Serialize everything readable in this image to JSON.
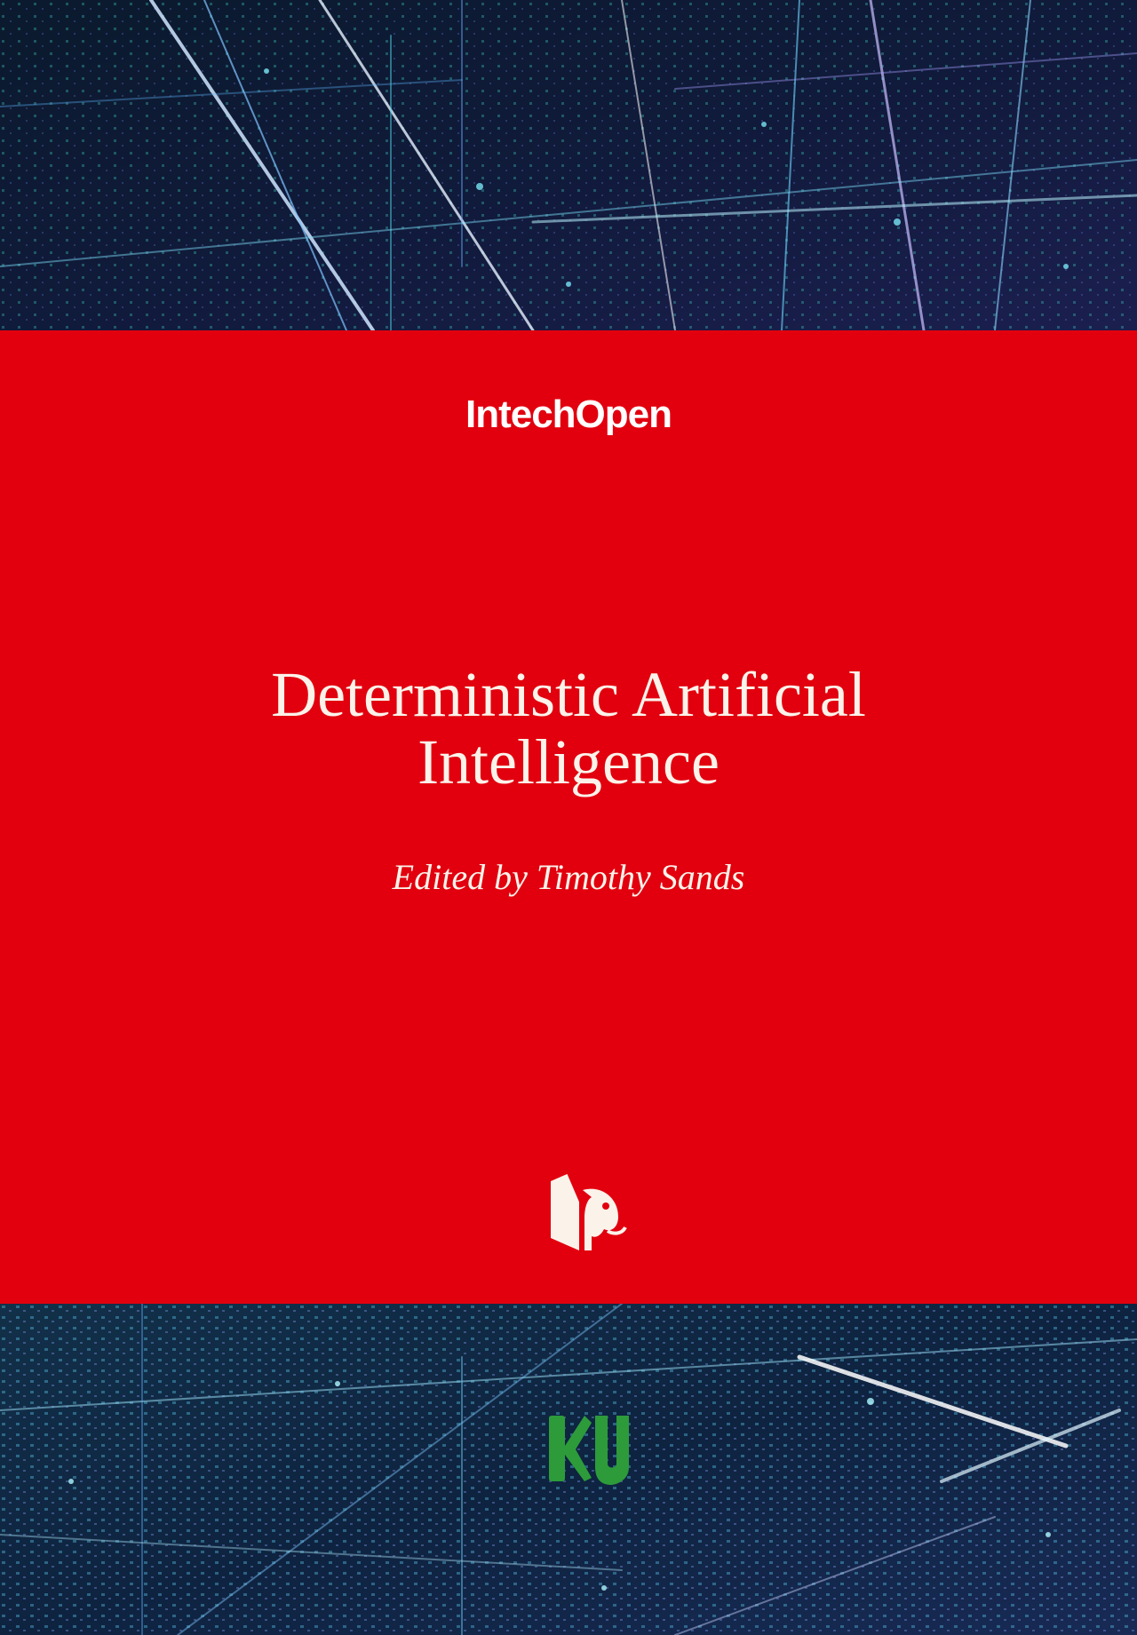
{
  "cover": {
    "publisher": "IntechOpen",
    "title_lines": [
      "Deterministic Artificial",
      "Intelligence"
    ],
    "editor": "Edited by Timothy Sands"
  },
  "colors": {
    "band": "#e2000f",
    "text": "#fbf3ea",
    "ku_logo": "#2d9b3a",
    "background": "#0a1224"
  },
  "icons": {
    "publisher_emblem": "intechopen-emblem-icon",
    "ku_logo": "knowledge-unlatched-logo-icon"
  }
}
